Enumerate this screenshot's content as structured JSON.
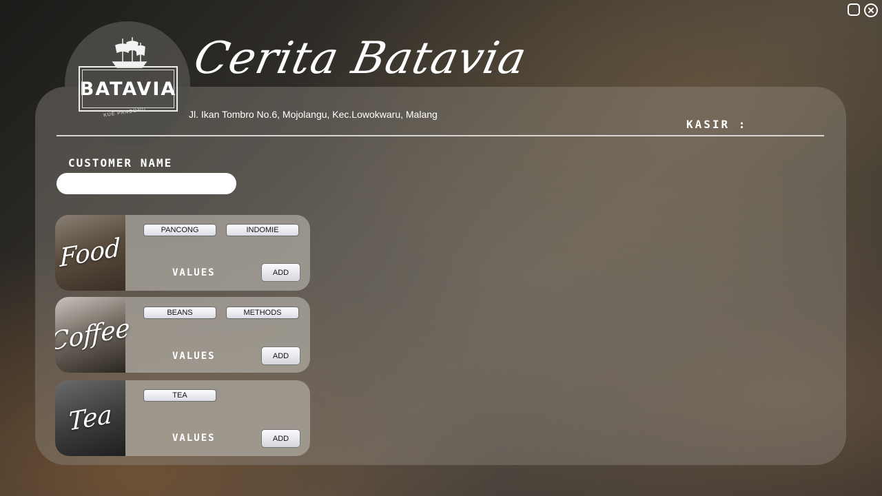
{
  "app": {
    "title": "Cerita Batavia",
    "address": "Jl. Ikan Tombro No.6, Mojolangu, Kec.Lowokwaru, Malang",
    "logo_text": "BATAVIA",
    "logo_subtext": "KUE PANCONG",
    "kasir_label": "KASIR :",
    "customer_label": "CUSTOMER NAME",
    "customer_value": ""
  },
  "cards": {
    "food": {
      "title": "Food",
      "options": [
        "PANCONG",
        "INDOMIE"
      ],
      "values_label": "VALUES",
      "add_label": "ADD"
    },
    "coffee": {
      "title": "Coffee",
      "options": [
        "BEANS",
        "METHODS"
      ],
      "values_label": "VALUES",
      "add_label": "ADD"
    },
    "tea": {
      "title": "Tea",
      "options": [
        "TEA"
      ],
      "values_label": "VALUES",
      "add_label": "ADD"
    }
  },
  "window_controls": [
    "maximize-icon",
    "close-icon"
  ]
}
